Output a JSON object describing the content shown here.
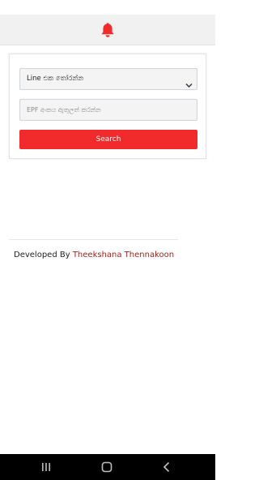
{
  "colors": {
    "accent": "#f12b2b",
    "developer_name": "#a8201a",
    "header_bg": "#f1f1f1",
    "nav_bar_bg": "#000000"
  },
  "header": {
    "icon": "bell-icon"
  },
  "form": {
    "line_select": {
      "selected": "Line එක තෝරන්න"
    },
    "epf_input": {
      "value": "",
      "placeholder": "EPF අංකය ඇතුලත් කරන්න"
    },
    "search_label": "Search"
  },
  "footer": {
    "prefix": "Developed By",
    "developer": "Theekshana Thennakoon"
  },
  "nav_bar": {
    "icons": [
      "recent-apps-icon",
      "home-icon",
      "back-icon"
    ]
  }
}
